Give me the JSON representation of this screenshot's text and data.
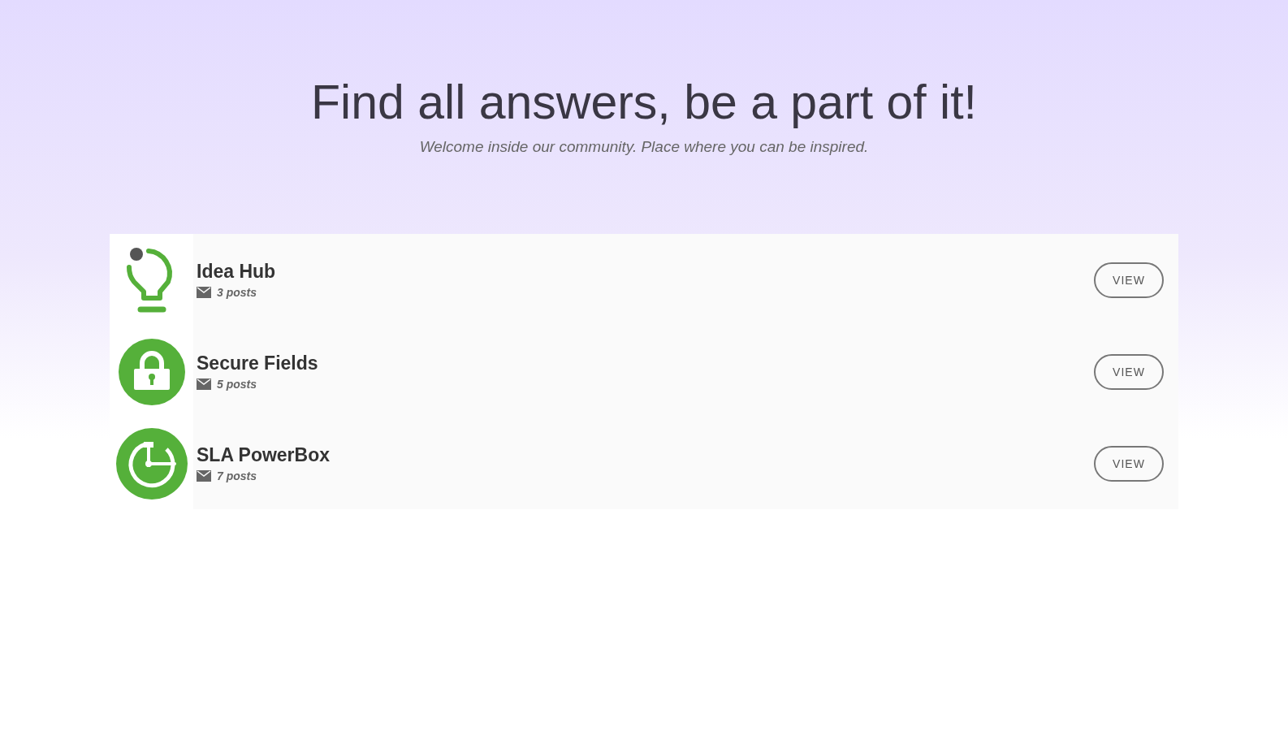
{
  "header": {
    "title": "Find all answers, be a part of it!",
    "subtitle": "Welcome inside our community. Place where you can be inspired."
  },
  "categories": [
    {
      "kind": "bulb",
      "name": "Idea Hub",
      "posts": "3 posts",
      "action": "VIEW"
    },
    {
      "kind": "lock",
      "name": "Secure Fields",
      "posts": "5 posts",
      "action": "VIEW"
    },
    {
      "kind": "clock",
      "name": "SLA PowerBox",
      "posts": "7 posts",
      "action": "VIEW"
    }
  ]
}
